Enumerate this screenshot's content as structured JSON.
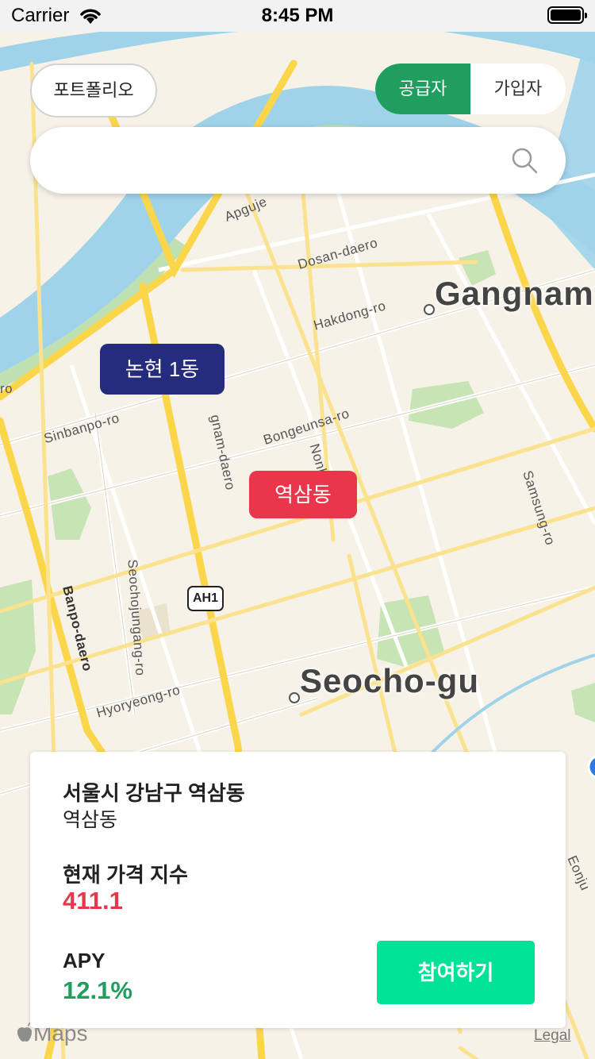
{
  "status_bar": {
    "carrier": "Carrier",
    "time": "8:45 PM"
  },
  "top_controls": {
    "portfolio_label": "포트폴리오",
    "segment": {
      "options": [
        "공급자",
        "가입자"
      ],
      "selected": "공급자"
    }
  },
  "search": {
    "value": "",
    "placeholder": ""
  },
  "map": {
    "districts": [
      "Gangnam",
      "Seocho-gu"
    ],
    "roads": [
      "Apguje",
      "Dosan-daero",
      "Hakdong-ro",
      "Sinbanpo-ro",
      "gnam-daero",
      "Bongeunsa-ro",
      "Nonh",
      "Samsung-ro",
      "Seochojungang-ro",
      "Banpo-daero",
      "Hyoryeong-ro",
      "Eonju",
      "ro"
    ],
    "highway_shield": "AH1",
    "markers": [
      {
        "label": "논현 1동",
        "color": "#252c7e"
      },
      {
        "label": "역삼동",
        "color": "#e8364a"
      }
    ],
    "maps_logo": "Maps",
    "legal": "Legal"
  },
  "info_card": {
    "address": "서울시 강남구 역삼동",
    "dong": "역삼동",
    "index_label": "현재 가격 지수",
    "index_value": "411.1",
    "apy_label": "APY",
    "apy_value": "12.1%",
    "join_label": "참여하기"
  },
  "colors": {
    "accent_green": "#1f9e5f",
    "join_green": "#00e296",
    "price_red": "#e8364a",
    "marker_navy": "#252c7e"
  }
}
